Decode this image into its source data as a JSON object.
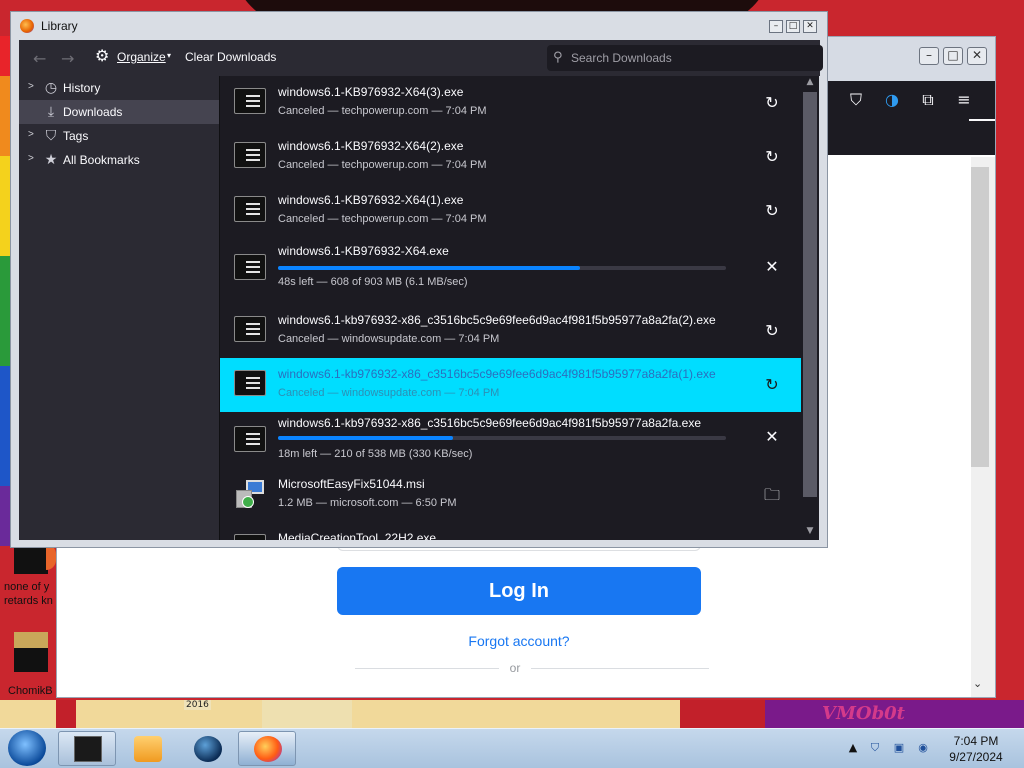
{
  "library": {
    "title": "Library",
    "toolbar": {
      "organize_label": "Organize",
      "clear_downloads_label": "Clear Downloads",
      "search_placeholder": "Search Downloads"
    },
    "tree": [
      {
        "label": "History",
        "icon": "clock-icon",
        "expandable": true,
        "selected": false
      },
      {
        "label": "Downloads",
        "icon": "download-icon",
        "expandable": false,
        "selected": true
      },
      {
        "label": "Tags",
        "icon": "tag-icon",
        "expandable": true,
        "selected": false
      },
      {
        "label": "All Bookmarks",
        "icon": "star-icon",
        "expandable": true,
        "selected": false
      }
    ],
    "downloads": [
      {
        "name": "windows6.1-KB976932-X64(3).exe",
        "status": "Canceled — techpowerup.com — 7:04 PM",
        "action": "retry"
      },
      {
        "name": "windows6.1-KB976932-X64(2).exe",
        "status": "Canceled — techpowerup.com — 7:04 PM",
        "action": "retry"
      },
      {
        "name": "windows6.1-KB976932-X64(1).exe",
        "status": "Canceled — techpowerup.com — 7:04 PM",
        "action": "retry"
      },
      {
        "name": "windows6.1-KB976932-X64.exe",
        "status": "48s left — 608 of 903 MB (6.1 MB/sec)",
        "action": "cancel",
        "progress": 0.673
      },
      {
        "name": "windows6.1-kb976932-x86_c3516bc5c9e69fee6d9ac4f981f5b95977a8a2fa(2).exe",
        "status": "Canceled — windowsupdate.com — 7:04 PM",
        "action": "retry"
      },
      {
        "name": "windows6.1-kb976932-x86_c3516bc5c9e69fee6d9ac4f981f5b95977a8a2fa(1).exe",
        "status": "Canceled — windowsupdate.com — 7:04 PM",
        "action": "retry",
        "selected": true
      },
      {
        "name": "windows6.1-kb976932-x86_c3516bc5c9e69fee6d9ac4f981f5b95977a8a2fa.exe",
        "status": "18m left — 210 of 538 MB (330 KB/sec)",
        "action": "cancel",
        "progress": 0.39
      },
      {
        "name": "MicrosoftEasyFix51044.msi",
        "status": "1.2 MB — microsoft.com — 6:50 PM",
        "action": "folder",
        "icon": "installer-icon"
      },
      {
        "name": "MediaCreationTool_22H2.exe",
        "status": "",
        "action": "folder"
      }
    ]
  },
  "browser": {
    "login_button": "Log In",
    "forgot_link": "Forgot account?",
    "or_text": "or"
  },
  "desktop": {
    "icon1_label": "none of y retards kn",
    "icon2_label": "ChomikB",
    "badge_2016": "2016",
    "wallpaper_text": "VMOb0t"
  },
  "taskbar": {
    "time": "7:04 PM",
    "date": "9/27/2024"
  }
}
